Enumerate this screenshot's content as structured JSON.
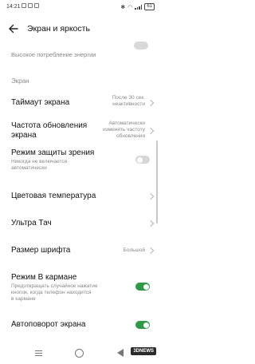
{
  "statusbar": {
    "time": "14:21",
    "battery": "61"
  },
  "appbar": {
    "title": "Экран и яркость"
  },
  "ghost_row": {
    "text": "Высокое потребление энергии"
  },
  "section": {
    "label": "Экран"
  },
  "rows": {
    "timeout": {
      "label": "Таймаут экрана",
      "value_line1": "После 30 сек.",
      "value_line2": "неактивности"
    },
    "refresh": {
      "label_line1": "Частота обновления",
      "label_line2": "экрана",
      "value_line1": "Автоматически",
      "value_line2": "изменять частоту",
      "value_line3": "обновления"
    },
    "eye": {
      "label": "Режим защиты зрения",
      "sub_line1": "Никогда не включается",
      "sub_line2": "автоматически",
      "toggle": "off"
    },
    "color_temp": {
      "label": "Цветовая температура"
    },
    "ultra_touch": {
      "label": "Ультра Тач"
    },
    "font_size": {
      "label": "Размер шрифта",
      "value": "Большой"
    },
    "pocket": {
      "label": "Режим В кармане",
      "sub_line1": "Предотвращать случайное нажатие",
      "sub_line2": "кнопок, когда телефон находится",
      "sub_line3": "в кармане",
      "toggle": "on"
    },
    "autorotate": {
      "label": "Автоповорот экрана",
      "toggle": "on"
    }
  },
  "watermark": {
    "text": "3DNEWS"
  },
  "colors": {
    "toggle_on": "#2e9a47",
    "toggle_off": "#d6d6d6"
  }
}
